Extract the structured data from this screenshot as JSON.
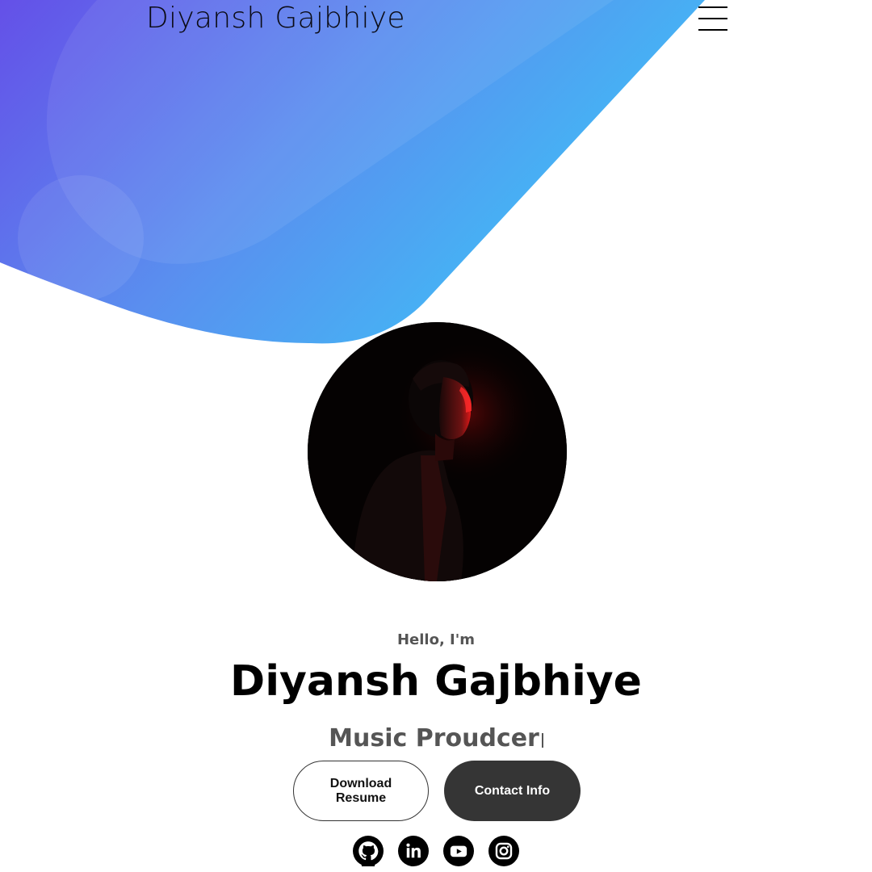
{
  "nav": {
    "logo": "Diyansh Gajbhiye",
    "menu_icon": "hamburger-menu-icon"
  },
  "profile": {
    "image": "profile-photo"
  },
  "hero": {
    "greeting": "Hello, I'm",
    "name": "Diyansh Gajbhiye",
    "role": "Music Proudcer"
  },
  "buttons": {
    "resume_label": "Download Resume",
    "contact_label": "Contact Info"
  },
  "socials": [
    {
      "icon": "github-icon"
    },
    {
      "icon": "linkedin-icon"
    },
    {
      "icon": "youtube-icon"
    },
    {
      "icon": "instagram-icon"
    }
  ],
  "colors": {
    "blob_start": "#6350e8",
    "blob_end": "#3fb9f4",
    "contact_button": "#353535",
    "text_muted": "#555555"
  }
}
